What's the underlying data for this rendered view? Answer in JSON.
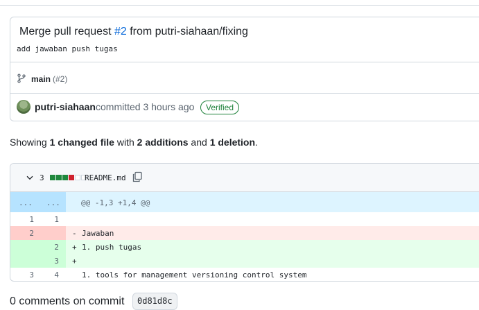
{
  "commit": {
    "title_prefix": "Merge pull request ",
    "pr_ref": "#2",
    "title_suffix": " from putri-siahaan/fixing",
    "description": "add jawaban push tugas",
    "branch": "main",
    "branch_pr": "(#2)",
    "author": "putri-siahaan",
    "meta": "committed 3 hours ago",
    "verified_label": "Verified"
  },
  "summary": {
    "prefix": "Showing ",
    "changed": "1 changed file",
    "mid": " with ",
    "additions": "2 additions",
    "and": " and ",
    "deletions": "1 deletion",
    "suffix": "."
  },
  "file": {
    "change_count": "3",
    "diffstat": [
      "add",
      "add",
      "add",
      "del",
      "neutral",
      "neutral"
    ],
    "name": "README.md",
    "hunk_left": "...",
    "hunk_right": "...",
    "hunk_header": "@@ -1,3 +1,4 @@",
    "lines": [
      {
        "old": "1",
        "new": "1",
        "sign": " ",
        "text": "",
        "type": "context"
      },
      {
        "old": "2",
        "new": "",
        "sign": "-",
        "text": "Jawaban",
        "type": "del"
      },
      {
        "old": "",
        "new": "2",
        "sign": "+",
        "text": "1. push tugas",
        "type": "add"
      },
      {
        "old": "",
        "new": "3",
        "sign": "+",
        "text": "",
        "type": "add"
      },
      {
        "old": "3",
        "new": "4",
        "sign": " ",
        "text": "1. tools for management versioning control system",
        "type": "context"
      }
    ]
  },
  "comments": {
    "title": "0 comments on commit",
    "sha": "0d81d8c"
  },
  "colors": {
    "link": "#0969da",
    "verified": "#1a7f37",
    "add_bg": "#e6ffec",
    "del_bg": "#ffebe9",
    "hunk_bg": "#ddf4ff"
  }
}
